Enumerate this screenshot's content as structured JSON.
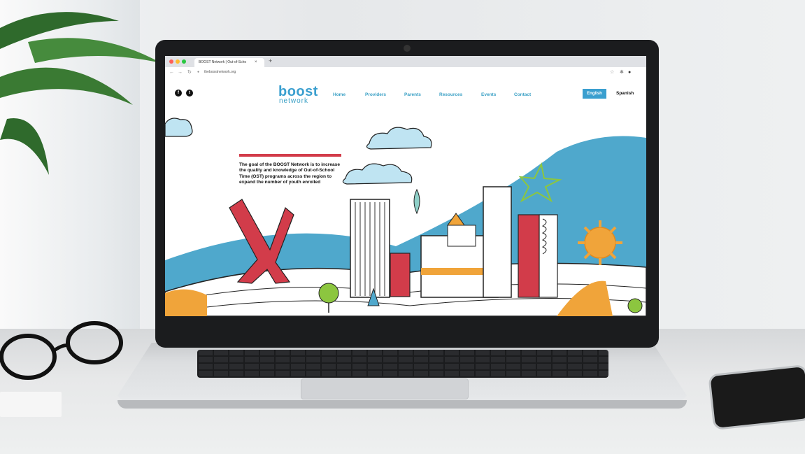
{
  "browser": {
    "tab_title": "BOOST Network | Out-of-Scho",
    "tab_close": "×",
    "new_tab": "+",
    "url": "theboostnetwork.org"
  },
  "site": {
    "logo_top": "boost",
    "logo_bottom": "network",
    "nav": [
      "Home",
      "Providers",
      "Parents",
      "Resources",
      "Events",
      "Contact"
    ],
    "lang_english": "English",
    "lang_spanish": "Spanish",
    "tagline": "The goal of the BOOST Network is to increase the quality and knowledge of Out-of-School Time (OST) programs across the region to expand the number of youth enrolled",
    "social": [
      "f",
      "t"
    ]
  },
  "colors": {
    "accent": "#3a9fcf",
    "red": "#d23c4a",
    "wave_blue": "#4fa8cc",
    "orange": "#f0a43a",
    "green": "#8cc63f"
  }
}
